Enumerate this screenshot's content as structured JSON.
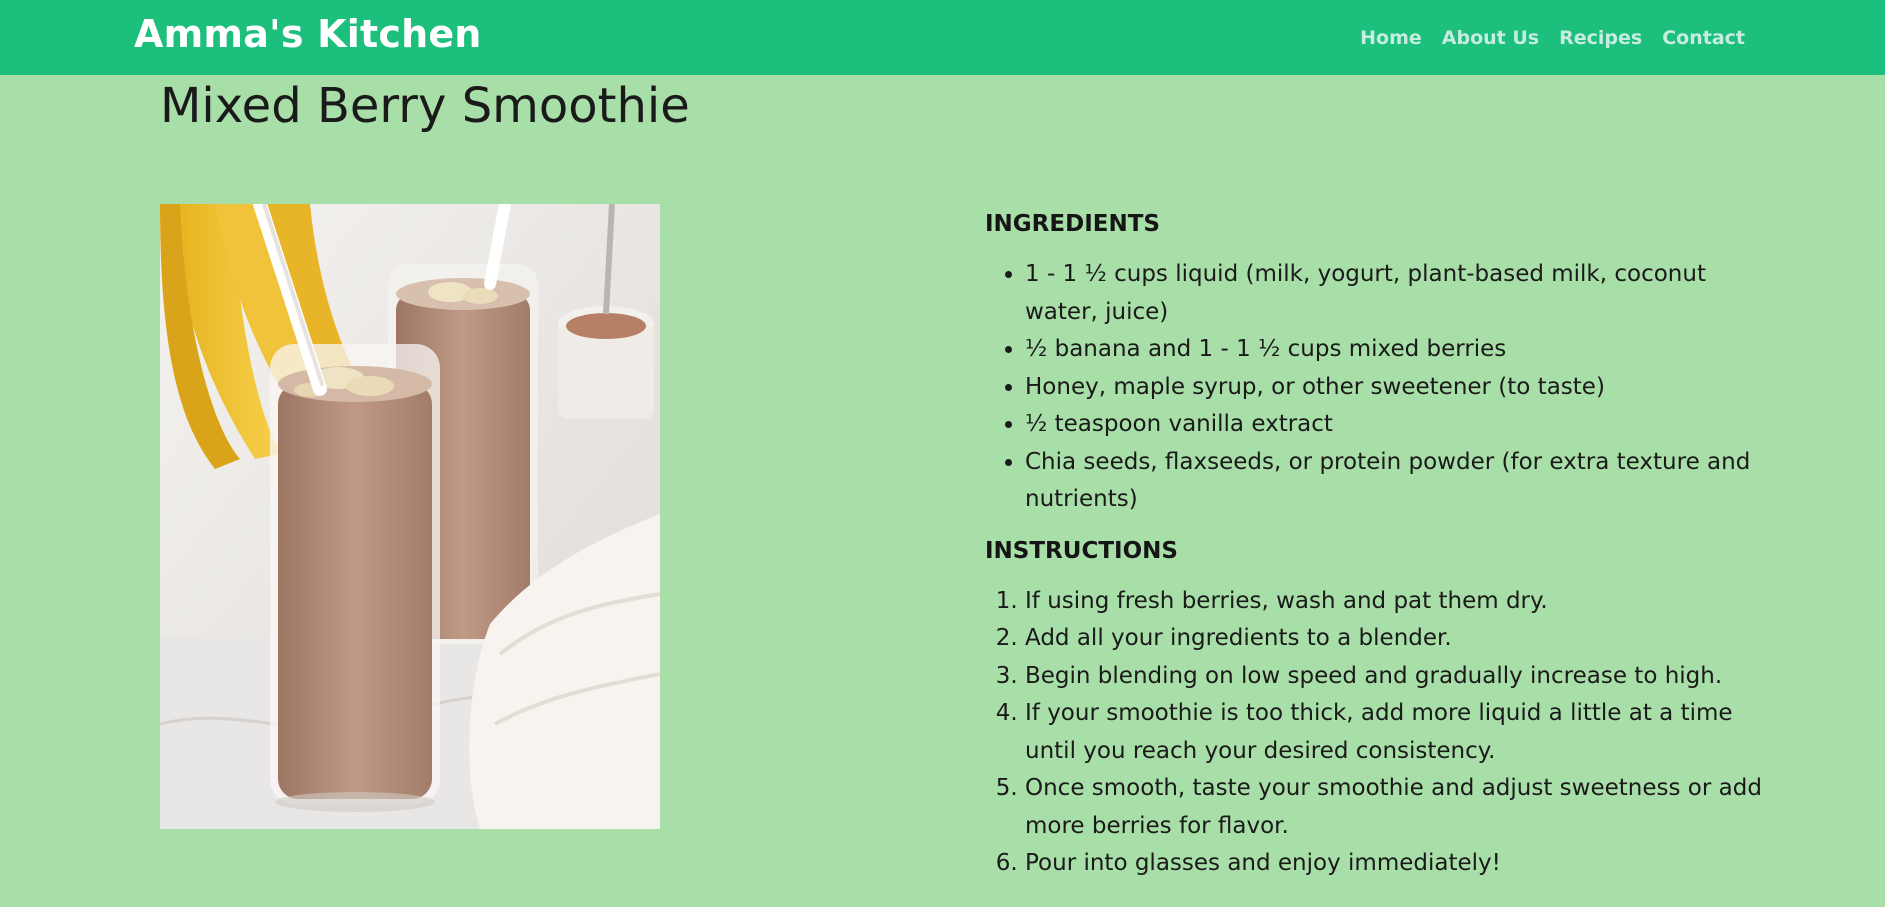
{
  "site": {
    "brand": "Amma's Kitchen"
  },
  "nav": {
    "items": [
      {
        "label": "Home"
      },
      {
        "label": "About Us"
      },
      {
        "label": "Recipes"
      },
      {
        "label": "Contact"
      }
    ]
  },
  "recipe": {
    "title": "Mixed Berry Smoothie",
    "image_icon": "smoothie-photo",
    "ingredients_heading": "INGREDIENTS",
    "ingredients": [
      "1 - 1 ½ cups liquid (milk, yogurt, plant-based milk, coconut water, juice)",
      "½ banana and 1 - 1 ½ cups mixed berries",
      "Honey, maple syrup, or other sweetener (to taste)",
      "½ teaspoon vanilla extract",
      "Chia seeds, flaxseeds, or protein powder (for extra texture and nutrients)"
    ],
    "instructions_heading": "INSTRUCTIONS",
    "instructions": [
      "If using fresh berries, wash and pat them dry.",
      "Add all your ingredients to a blender.",
      "Begin blending on low speed and gradually increase to high.",
      "If your smoothie is too thick, add more liquid a little at a time until you reach your desired consistency.",
      "Once smooth, taste your smoothie and adjust sweetness or add more berries for flavor.",
      "Pour into glasses and enjoy immediately!"
    ]
  },
  "colors": {
    "navbar": "#1cbf7c",
    "page_background": "#a8dea7",
    "brand_text": "#ffffff",
    "nav_text": "#c7ece0"
  }
}
